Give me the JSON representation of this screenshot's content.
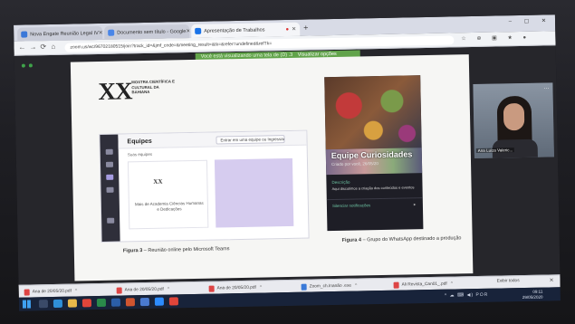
{
  "browser": {
    "tabs": [
      {
        "label": "Nova Engate Reunião Legal IV",
        "active": false,
        "favicon_color": "#3b78d8"
      },
      {
        "label": "Documento sem título - Google",
        "active": false,
        "favicon_color": "#4a86e8"
      },
      {
        "label": "Apresentação de Trabalhos",
        "active": true,
        "favicon_color": "#1a73e8"
      }
    ],
    "new_tab_label": "+",
    "window_controls": "– ▢ ✕",
    "nav": {
      "back": "←",
      "forward": "→",
      "reload": "⟳",
      "home": "⌂"
    },
    "url": "zoom.us/wc/96702180515/join?track_id=&jmf_code=&meeting_result=&tk=&refer=undefined&refTk=",
    "extension_icons": "☆ ⊕ ▣ ★ ●"
  },
  "share_banner": {
    "text": "Você está visualizando uma tela de (D) .3",
    "action": "Visualizar opções"
  },
  "slide": {
    "logo_big": "XX",
    "logo_text": "MOSTRA CIENTÍFICA E CULTURAL DA BAHIANA",
    "teams": {
      "title": "Equipes",
      "join_button": "Entrar em uma equipe ou Ingressar nela",
      "sub_label": "Suas equipes",
      "card_logo": "XX",
      "card_name": "Mais de Academia Ciências Humanas e Dedicações"
    },
    "figure3": {
      "label": "Figura 3",
      "caption": "– Reunião online pelo Microsoft Teams"
    },
    "whatsapp": {
      "group_name": "Equipe Curiosidades",
      "created": "Criado por você, 26/05/20",
      "description_label": "Descrição",
      "description": "Aqui discutimos a criação dos conteúdos e eventos",
      "notifications": "Silenciar notificações"
    },
    "figure4": {
      "label": "Figura 4",
      "caption": "– Grupo do WhatsApp destinado a produção"
    }
  },
  "participant": {
    "name": "Ana Luiza Valeric...",
    "more": "⋯"
  },
  "downloads": {
    "items": [
      {
        "label": "Ana de 20/05/20.pdf"
      },
      {
        "label": "Ana de 20/05/20.pdf"
      },
      {
        "label": "Ana de 20/05/20.pdf"
      },
      {
        "label": "Zoom_ch.Inanão .exe"
      },
      {
        "label": "Ali Revista_Can01_.pdf"
      }
    ],
    "show_all": "Exibir todos",
    "close": "✕"
  },
  "taskbar": {
    "icons": [
      {
        "name": "search",
        "color": "#3a4a68"
      },
      {
        "name": "edge",
        "color": "#2f8fd8"
      },
      {
        "name": "explorer",
        "color": "#e8b84a"
      },
      {
        "name": "chrome",
        "color": "#e0453a"
      },
      {
        "name": "excel",
        "color": "#2a8a4a"
      },
      {
        "name": "word",
        "color": "#2b5ea8"
      },
      {
        "name": "powerpoint",
        "color": "#d0552f"
      },
      {
        "name": "photos",
        "color": "#4a7ad0"
      },
      {
        "name": "zoom",
        "color": "#2d8cff"
      },
      {
        "name": "chrome2",
        "color": "#e0453a"
      }
    ],
    "tray": "^ ☁ ⌨ ◀) POR",
    "time": "09:11",
    "date": "29/05/2020"
  },
  "colors": {
    "share_green": "#61a34a",
    "teams_purple": "#d6ccef",
    "taskbar": "#18233a"
  }
}
